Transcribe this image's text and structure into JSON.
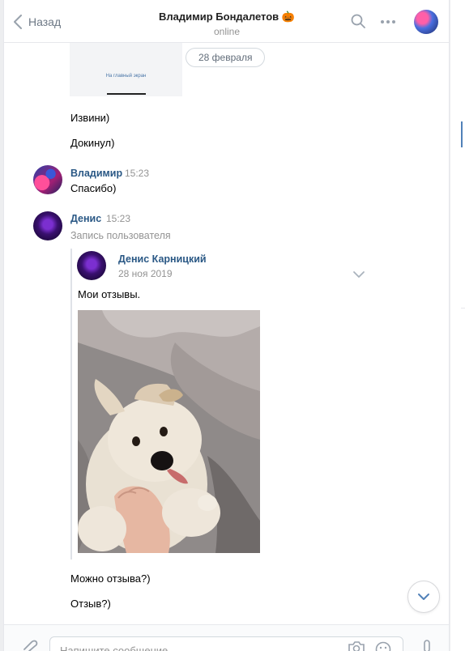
{
  "header": {
    "back_label": "Назад",
    "title": "Владимир Бондалетов 🎃",
    "status": "online"
  },
  "messages": {
    "prev_image_caption": "На главный экран",
    "date_separator": "28 февраля",
    "msg1": "Извини)",
    "msg2": "Докинул)",
    "vladimir": {
      "author": "Владимир",
      "time": "15:23",
      "text": "Спасибо)"
    },
    "denis": {
      "author": "Денис",
      "time": "15:23",
      "repost_label": "Запись пользователя",
      "repost": {
        "author": "Денис Карницкий",
        "date": "28 ноя 2019",
        "text": "Мои отзывы."
      }
    },
    "msg3": "Можно отзыва?)",
    "msg4": "Отзыв?)"
  },
  "composer": {
    "placeholder": "Напишите сообщение..."
  },
  "colors": {
    "link": "#2a5885",
    "muted": "#939393",
    "accent": "#5181b8"
  }
}
